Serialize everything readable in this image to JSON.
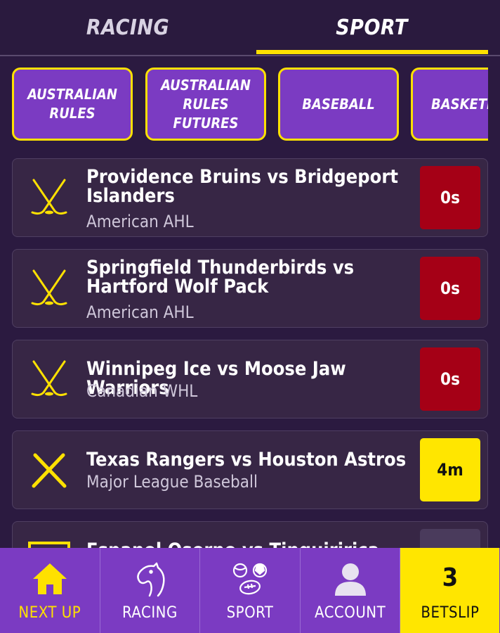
{
  "tabs": [
    {
      "label": "RACING",
      "active": false
    },
    {
      "label": "SPORT",
      "active": true
    }
  ],
  "categories": [
    {
      "lines": [
        "AUSTRALIAN",
        "RULES"
      ]
    },
    {
      "lines": [
        "AUSTRALIAN",
        "RULES",
        "FUTURES"
      ]
    },
    {
      "lines": [
        "BASEBALL"
      ]
    },
    {
      "lines": [
        "BASKETBALL"
      ]
    }
  ],
  "events": [
    {
      "title": "Providence Bruins vs Bridgeport Islanders",
      "league": "American AHL",
      "time": "0s",
      "icon": "hockey-sticks-icon",
      "status": "red"
    },
    {
      "title": "Springfield Thunderbirds vs Hartford Wolf Pack",
      "league": "American AHL",
      "time": "0s",
      "icon": "hockey-sticks-icon",
      "status": "red"
    },
    {
      "title": "Winnipeg Ice vs Moose Jaw Warriors",
      "league": "Canadian WHL",
      "time": "0s",
      "icon": "hockey-sticks-icon",
      "status": "red"
    },
    {
      "title": "Texas Rangers vs Houston Astros",
      "league": "Major League Baseball",
      "time": "4m",
      "icon": "baseball-bats-icon",
      "status": "yellow"
    },
    {
      "title": "Espanol Osorno vs Tinguiririca",
      "league": "",
      "time": "",
      "icon": "soccer-goal-icon",
      "status": "grey"
    }
  ],
  "bottom_nav": {
    "next_up": "NEXT UP",
    "racing": "RACING",
    "sport": "SPORT",
    "account": "ACCOUNT",
    "betslip": "BETSLIP",
    "betslip_count": "3"
  },
  "colors": {
    "background": "#2b1a40",
    "accent_yellow": "#ffe100",
    "purple": "#7b3bc2",
    "card": "#372645",
    "live_red": "#a50016"
  }
}
